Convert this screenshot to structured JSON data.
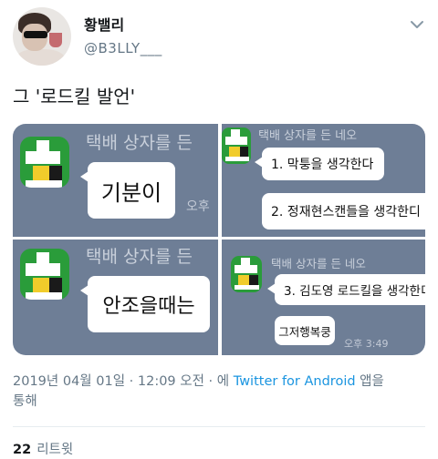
{
  "author": {
    "display_name": "황밸리",
    "handle": "@B3LLY___"
  },
  "tweet": {
    "text": "그 '로드킬 발언'"
  },
  "media": {
    "panel_a": {
      "title": "택배 상자를 든",
      "bubble": "기분이",
      "time": "오후"
    },
    "panel_b": {
      "title": "택배 상자를 든",
      "bubble": "안조을때는"
    },
    "panel_c": {
      "title": "택배 상자를 든 네오",
      "bubble1": "1.  막퉁을 생각한다",
      "bubble2": "2.  정재현스캔들을 생각한디"
    },
    "panel_d": {
      "title": "택배 상자를 든 네오",
      "bubble1": "3.  김도영 로드킬을 생각한디",
      "bubble2": "그저행복쿵",
      "time": "오후 3:49"
    }
  },
  "meta": {
    "timestamp": "2019년 04월 01일 · 12:09 오전 · 에",
    "source_link": "Twitter for Android",
    "suffix": "앱을",
    "line2": "통해"
  },
  "stats": {
    "retweet_count": "22",
    "retweet_label": "리트윗"
  },
  "icons": {
    "caret": "chevron-down-icon",
    "kakao_profile": "gift-box-profile-icon"
  },
  "colors": {
    "link": "#1b95e0",
    "secondary_text": "#657786",
    "chat_background": "#6e7e96"
  }
}
